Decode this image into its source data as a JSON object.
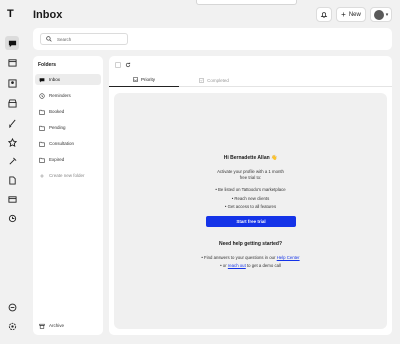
{
  "page_title": "Inbox",
  "header": {
    "new_label": "New",
    "new_icon": "plus-icon",
    "notification_icon": "bell-icon",
    "avatar_icon": "avatar-icon"
  },
  "rail": {
    "logo": "T",
    "icons": [
      "chat-icon",
      "calendar-icon",
      "portfolio-icon",
      "store-icon",
      "brush-icon",
      "star-icon",
      "tools-icon",
      "document-icon",
      "card-icon",
      "sync-icon",
      "support-chat-icon",
      "settings-icon"
    ]
  },
  "search": {
    "placeholder": "Search"
  },
  "folders": {
    "title": "Folders",
    "items": [
      {
        "label": "Inbox",
        "icon": "chat-icon"
      },
      {
        "label": "Reminders",
        "icon": "clock-icon"
      },
      {
        "label": "Booked",
        "icon": "folder-icon"
      },
      {
        "label": "Pending",
        "icon": "folder-icon"
      },
      {
        "label": "Consultation",
        "icon": "folder-icon"
      },
      {
        "label": "Expired",
        "icon": "folder-icon"
      },
      {
        "label": "Create new folder",
        "icon": "plus-icon"
      }
    ],
    "archive": "Archive"
  },
  "tabs": [
    {
      "label": "Priority",
      "icon": "inbox-icon"
    },
    {
      "label": "Completed",
      "icon": "check-icon"
    }
  ],
  "empty_state": {
    "greeting": "Hi Bernadette Allan 👋",
    "intro_line1": "Activate your profile with a 1 month",
    "intro_line2": "free trial to:",
    "bullets": [
      "• Be listed on Tattoodo's marketplace",
      "• Reach new clients",
      "• Get access to all features"
    ],
    "cta": "Start free trial",
    "help_title": "Need help getting started?",
    "help_line1_prefix": "• Find answers to your questions in our",
    "help_line1_link": "Help Center",
    "help_line2_prefix": "• or",
    "help_line2_link": "reach out",
    "help_line2_suffix": "to get a demo call"
  },
  "colors": {
    "accent": "#1433e8",
    "background": "#f1f1f1",
    "panel": "#f0f0f0"
  }
}
